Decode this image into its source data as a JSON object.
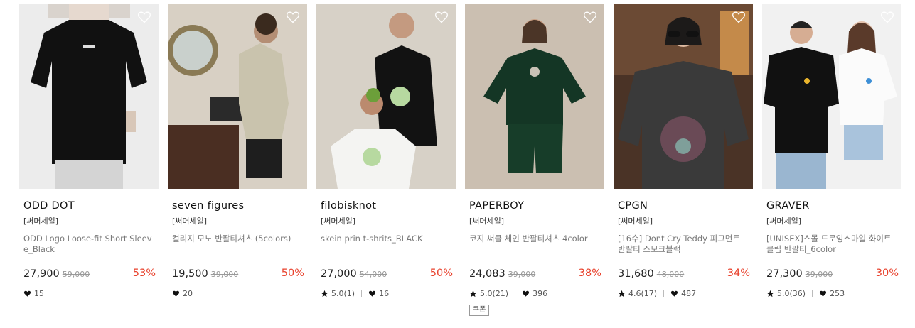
{
  "products": [
    {
      "brand": "ODD DOT",
      "tag": "[써머세일]",
      "name": "ODD Logo Loose-fit Short Sleeve_Black",
      "price": "27,900",
      "original_price": "59,000",
      "discount": "53%",
      "likes": "15"
    },
    {
      "brand": "seven figures",
      "tag": "[써머세일]",
      "name": "컬리지 모노 반팔티셔츠 (5colors)",
      "price": "19,500",
      "original_price": "39,000",
      "discount": "50%",
      "likes": "20"
    },
    {
      "brand": "filobisknot",
      "tag": "[써머세일]",
      "name": "skein prin t-shrits_BLACK",
      "price": "27,000",
      "original_price": "54,000",
      "discount": "50%",
      "rating": "5.0(1)",
      "likes": "16"
    },
    {
      "brand": "PAPERBOY",
      "tag": "[써머세일]",
      "name": "코지 써클 체인 반팔티셔츠 4color",
      "price": "24,083",
      "original_price": "39,000",
      "discount": "38%",
      "rating": "5.0(21)",
      "likes": "396",
      "coupon": "쿠폰"
    },
    {
      "brand": "CPGN",
      "tag": "[써머세일]",
      "name": "[16수] Dont Cry Teddy 피그먼트 반팔티 스모크블랙",
      "price": "31,680",
      "original_price": "48,000",
      "discount": "34%",
      "rating": "4.6(17)",
      "likes": "487"
    },
    {
      "brand": "GRAVER",
      "tag": "[써머세일]",
      "name": "[UNISEX]스몰 드로잉스마일 화이트 클립 반팔티_6color",
      "price": "27,300",
      "original_price": "39,000",
      "discount": "30%",
      "rating": "5.0(36)",
      "likes": "253"
    }
  ],
  "icons": {
    "wishlist": "heart-outline-icon",
    "likes": "heart-icon",
    "rating": "star-icon"
  },
  "colors": {
    "discount": "#e8412c",
    "price": "#222222",
    "original_price": "#999999"
  }
}
